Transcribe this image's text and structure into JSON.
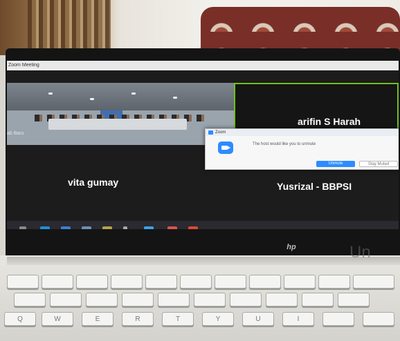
{
  "window": {
    "title": "Zoom Meeting"
  },
  "participants": [
    {
      "name": "ab Baru"
    },
    {
      "name": "arifin S Harah"
    },
    {
      "name": "vita gumay"
    },
    {
      "name": "Yusrizal  -  BBPSI"
    }
  ],
  "dialog": {
    "app": "Zoom",
    "message": "The host would like you to unmute",
    "unmute_label": "Unmute",
    "stay_muted_label": "Stay Muted"
  },
  "laptop": {
    "brand": "hp"
  },
  "keys": {
    "row1": [
      "",
      "",
      "",
      "",
      "",
      "",
      "",
      "",
      "",
      "",
      "",
      ""
    ],
    "row2": [
      "Q",
      "W",
      "E",
      "R",
      "T",
      "Y",
      "U",
      "I"
    ]
  },
  "watermark": "Un",
  "colors": {
    "zoom_blue": "#2d8cff",
    "active_speaker": "#6fc11e"
  }
}
